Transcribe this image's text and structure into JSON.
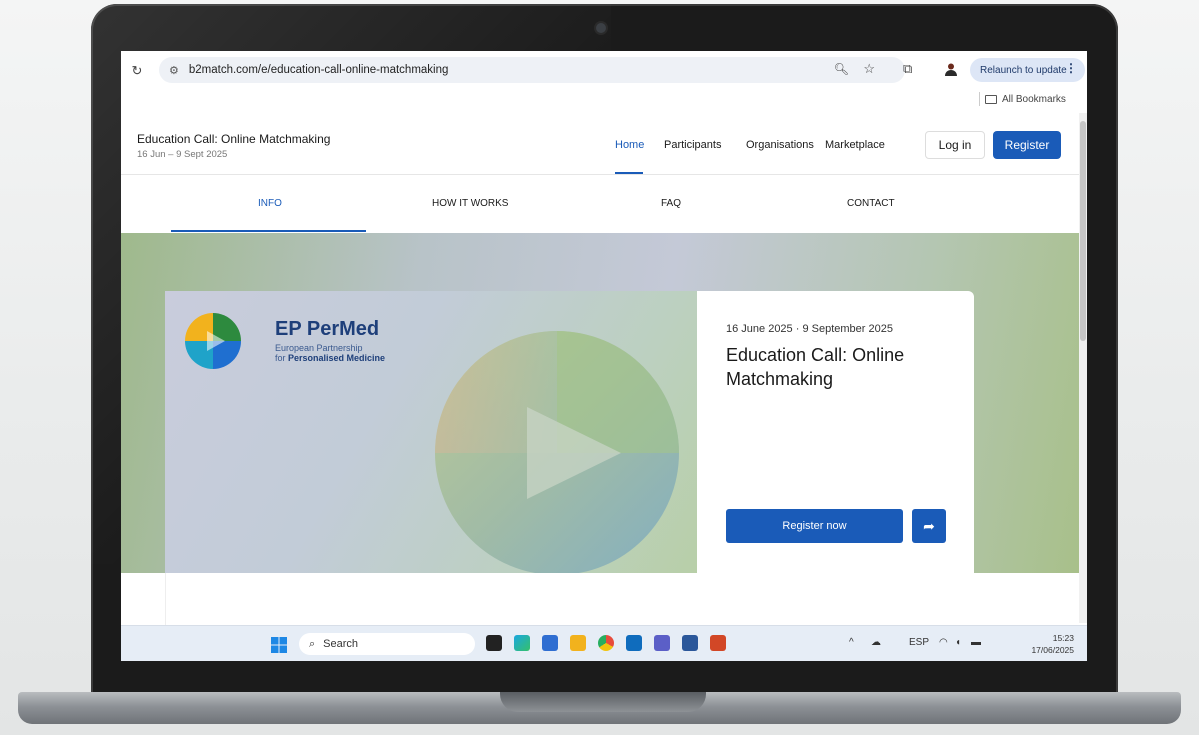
{
  "browser": {
    "url": "b2match.com/e/education-call-online-matchmaking",
    "relaunch_label": "Relaunch to update",
    "bookmarks_label": "All Bookmarks"
  },
  "site": {
    "event_title": "Education Call: Online Matchmaking",
    "event_dates": "16 Jun – 9 Sept 2025",
    "nav": [
      "Home",
      "Participants",
      "Organisations",
      "Marketplace"
    ],
    "login_label": "Log in",
    "register_label": "Register",
    "subtabs": [
      "INFO",
      "HOW IT WORKS",
      "FAQ",
      "CONTACT"
    ]
  },
  "hero": {
    "logo_name": "EP PerMed",
    "logo_sub1": "European Partnership",
    "logo_sub2_prefix": "for ",
    "logo_sub2_bold": "Personalised Medicine",
    "dates": "16 June 2025 · 9 September 2025",
    "title": "Education Call: Online Matchmaking",
    "register_now_label": "Register now"
  },
  "taskbar": {
    "search_label": "Search",
    "lang": "ESP",
    "time": "15:23",
    "date": "17/06/2025"
  },
  "colors": {
    "accent": "#1a5bb8",
    "logo_text": "#1e3f7a"
  }
}
